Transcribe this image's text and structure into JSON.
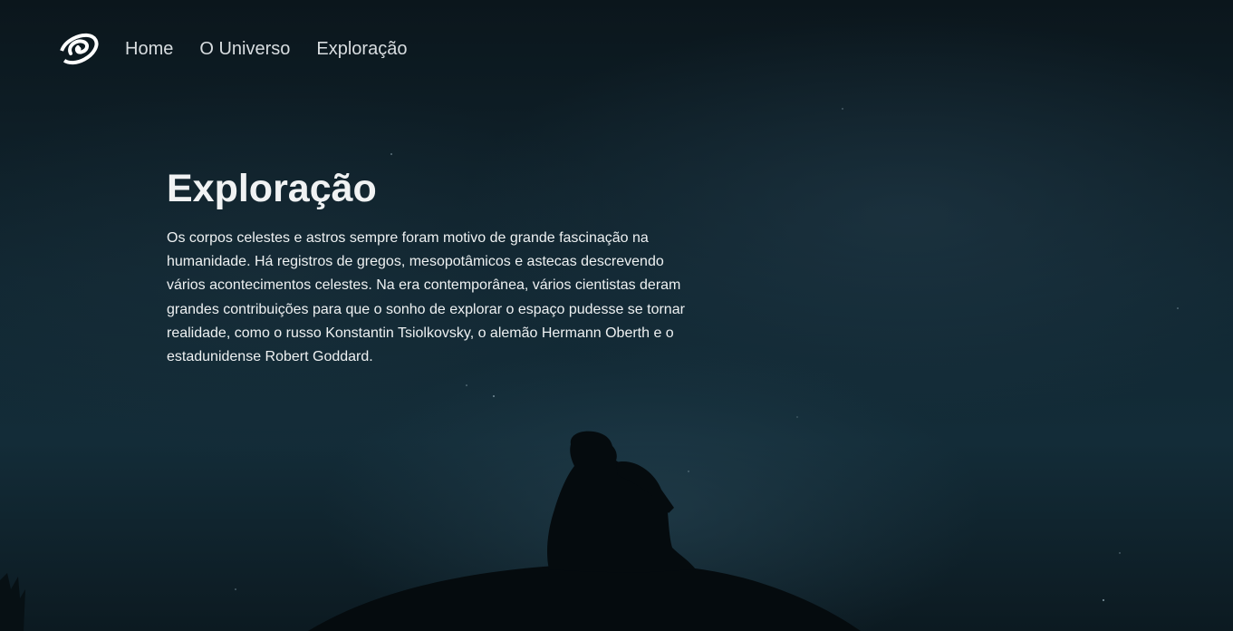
{
  "nav": {
    "logo_icon": "spiral-galaxy-icon",
    "items": [
      {
        "label": "Home"
      },
      {
        "label": "O Universo"
      },
      {
        "label": "Exploração"
      }
    ]
  },
  "main": {
    "title": "Exploração",
    "paragraph": "Os corpos celestes e astros sempre foram motivo de grande fascinação na humanidade. Há registros de gregos, mesopotâmicos e astecas descrevendo vários acontecimentos celestes. Na era contemporânea, vários cientistas deram grandes contribuições para que o sonho de explorar o espaço pudesse se tornar realidade, como o russo Konstantin Tsiolkovsky, o alemão Hermann Oberth e o estadunidense Robert Goddard."
  },
  "colors": {
    "background": "#0a1419",
    "text": "#eef1f2",
    "nav_text": "#d8dde0"
  }
}
